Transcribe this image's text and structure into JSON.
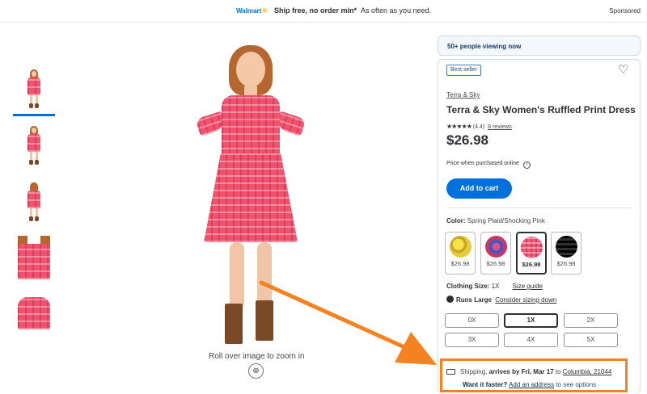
{
  "banner": {
    "logo": "Walmart",
    "message_bold": "Ship free, no order min*",
    "message_rest": "As often as you need.",
    "sponsored": "Sponsored"
  },
  "gallery": {
    "zoom_hint": "Roll over image to zoom in"
  },
  "viewing_badge": "50+ people viewing now",
  "product": {
    "badge": "Best seller",
    "brand": "Terra & Sky",
    "title": "Terra & Sky Women's Ruffled Print Dress",
    "stars": "★★★★★",
    "rating": "(4.4)",
    "reviews": "8 reviews",
    "price": "$26.98",
    "price_note": "Price when purchased online",
    "add_to_cart": "Add to cart"
  },
  "color": {
    "label": "Color",
    "selected": "Spring Plaid/Shocking Pink",
    "swatches": [
      {
        "price": "$26.98"
      },
      {
        "price": "$26.98"
      },
      {
        "price": "$26.98"
      },
      {
        "price": "$26.98"
      }
    ]
  },
  "size": {
    "label": "Clothing Size",
    "selected": "1X",
    "guide": "Size guide",
    "runs_label": "Runs Large",
    "runs_link": "Consider sizing down",
    "options": [
      "0X",
      "1X",
      "2X",
      "3X",
      "4X",
      "5X"
    ]
  },
  "shipping": {
    "prefix": "Shipping,",
    "arrives": "arrives by Fri, Mar 17",
    "to": "to",
    "location": "Columbia, 21044",
    "faster_q": "Want it faster?",
    "add_address": "Add an address",
    "suffix": "to see options"
  },
  "colors": {
    "accent": "#0071dc",
    "highlight": "#f58220"
  }
}
